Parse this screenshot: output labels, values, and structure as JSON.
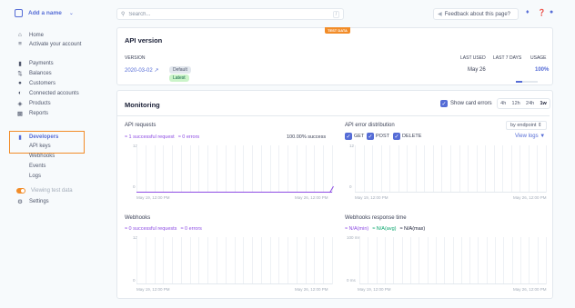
{
  "sidebar": {
    "account_name": "Add a name",
    "items": [
      {
        "label": "Home",
        "icon": "home-icon"
      },
      {
        "label": "Activate your account",
        "icon": "list-icon"
      },
      {
        "label": "Payments",
        "icon": "card-icon"
      },
      {
        "label": "Balances",
        "icon": "balance-icon"
      },
      {
        "label": "Customers",
        "icon": "customer-icon"
      },
      {
        "label": "Connected accounts",
        "icon": "connected-icon"
      },
      {
        "label": "Products",
        "icon": "box-icon"
      },
      {
        "label": "Reports",
        "icon": "chart-icon"
      }
    ],
    "developers": {
      "label": "Developers",
      "subitems": [
        "API keys",
        "Webhooks",
        "Events",
        "Logs"
      ]
    },
    "test_data_label": "Viewing test data",
    "settings_label": "Settings"
  },
  "topbar": {
    "search_placeholder": "Search...",
    "search_shortcut": "/",
    "feedback_label": "Feedback about this page?"
  },
  "api_version": {
    "title": "API version",
    "test_badge": "TEST DATA",
    "columns": [
      "VERSION",
      "LAST USED",
      "LAST 7 DAYS",
      "USAGE"
    ],
    "version": "2020-03-02",
    "default_pill": "Default",
    "latest_pill": "Latest",
    "last_used": "May 26",
    "usage": "100%",
    "usage_fraction": 1.0
  },
  "monitoring": {
    "title": "Monitoring",
    "show_card_errors": "Show card errors",
    "ranges": [
      "4h",
      "12h",
      "24h",
      "1w"
    ],
    "active_range": "1w",
    "api_requests": {
      "title": "API requests",
      "legend_success": "1 successful request",
      "legend_errors": "0 errors",
      "success_rate": "100.00% success",
      "y_top": "12",
      "y_bottom": "0",
      "x_start": "May 19, 12:00 PM",
      "x_end": "May 26, 12:00 PM"
    },
    "api_errors": {
      "title": "API error distribution",
      "endpoint_select": "by endpoint",
      "methods": [
        "GET",
        "POST",
        "DELETE"
      ],
      "view_logs": "View logs",
      "y_top": "12",
      "y_bottom": "0",
      "x_start": "May 19, 12:00 PM",
      "x_end": "May 26, 12:00 PM"
    },
    "webhooks": {
      "title": "Webhooks",
      "legend_success": "0 successful requests",
      "legend_errors": "0 errors",
      "y_top": "12",
      "y_bottom": "0",
      "x_start": "May 19, 12:00 PM",
      "x_end": "May 26, 12:00 PM"
    },
    "webhooks_response": {
      "title": "Webhooks response time",
      "legend_min": "N/A(min)",
      "legend_avg": "N/A(avg)",
      "legend_max": "N/A(max)",
      "y_top": "100 ms",
      "y_bottom": "0 ms",
      "x_start": "May 19, 12:00 PM",
      "x_end": "May 26, 12:00 PM"
    }
  }
}
